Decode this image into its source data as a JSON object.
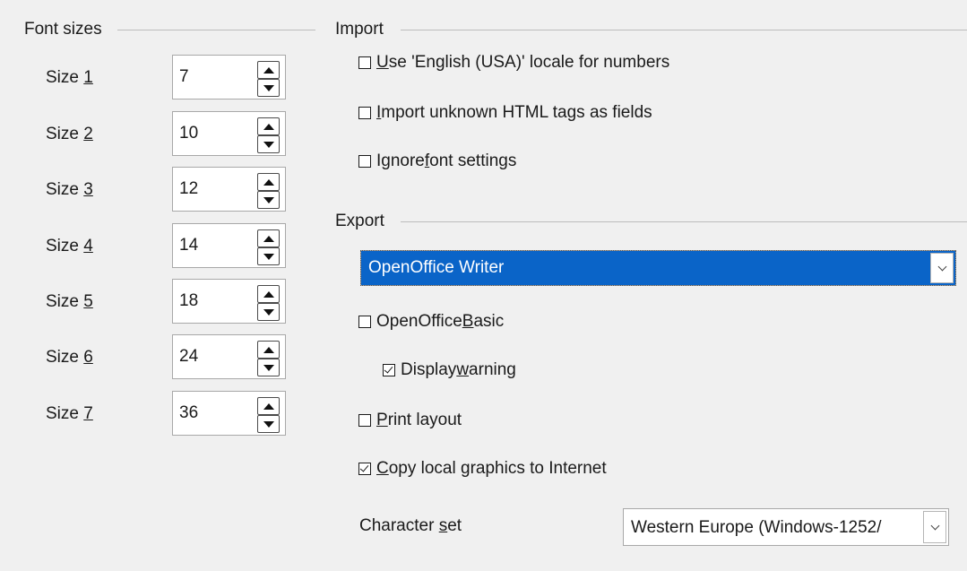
{
  "font_sizes": {
    "legend": "Font sizes",
    "rows": [
      {
        "prefix": "Size ",
        "key": "1",
        "value": "7"
      },
      {
        "prefix": "Size ",
        "key": "2",
        "value": "10"
      },
      {
        "prefix": "Size ",
        "key": "3",
        "value": "12"
      },
      {
        "prefix": "Size ",
        "key": "4",
        "value": "14"
      },
      {
        "prefix": "Size ",
        "key": "5",
        "value": "18"
      },
      {
        "prefix": "Size ",
        "key": "6",
        "value": "24"
      },
      {
        "prefix": "Size ",
        "key": "7",
        "value": "36"
      }
    ]
  },
  "import": {
    "legend": "Import",
    "use_locale": {
      "pre": "",
      "key": "U",
      "post": "se 'English (USA)' locale for numbers",
      "checked": false
    },
    "unknown_tags": {
      "pre": "",
      "key": "I",
      "post": "mport unknown HTML tags as fields",
      "checked": false
    },
    "ignore_font": {
      "pre": "Ignore ",
      "key": "f",
      "post": "ont settings",
      "checked": false
    }
  },
  "export": {
    "legend": "Export",
    "format_selected": "OpenOffice Writer",
    "oo_basic": {
      "pre": "OpenOffice ",
      "key": "B",
      "post": "asic",
      "checked": false
    },
    "display_warning": {
      "pre": "Display ",
      "key": "w",
      "post": "arning",
      "checked": true
    },
    "print_layout": {
      "pre": "",
      "key": "P",
      "post": "rint layout",
      "checked": false
    },
    "copy_graphics": {
      "pre": "",
      "key": "C",
      "post": "opy local graphics to Internet",
      "checked": true
    },
    "charset": {
      "pre": "Character ",
      "key": "s",
      "post": "et",
      "value": "Western Europe (Windows-1252/"
    }
  },
  "colors": {
    "selection": "#0a64c8",
    "background": "#f0f0f0"
  }
}
